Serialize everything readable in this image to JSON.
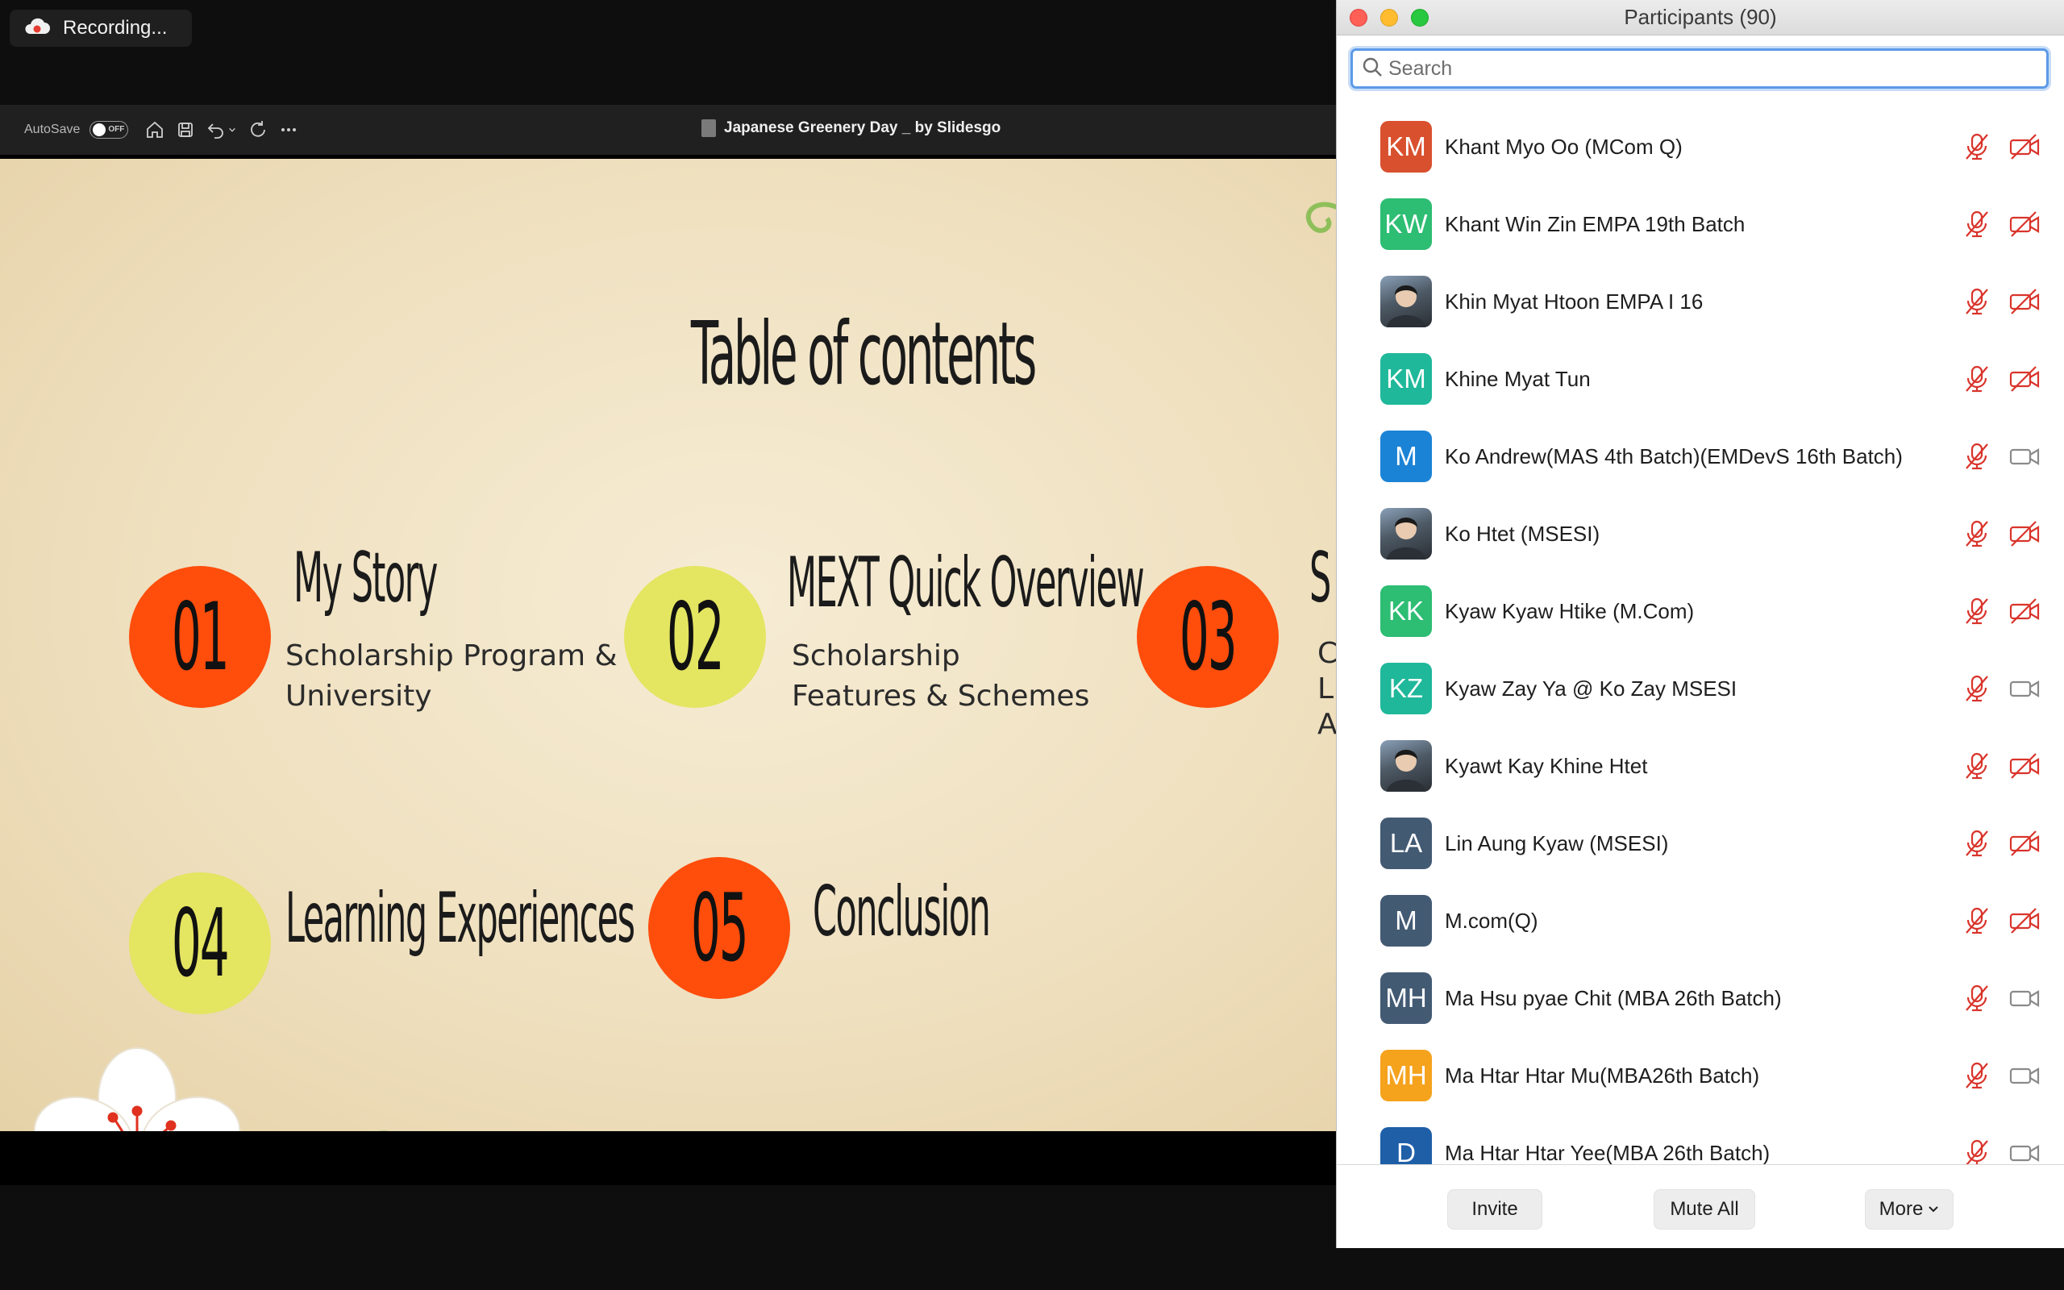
{
  "recording": {
    "label": "Recording..."
  },
  "ppt": {
    "autosave_label": "AutoSave",
    "autosave_state": "OFF",
    "document_title": "Japanese Greenery Day _ by Slidesgo"
  },
  "slide": {
    "title": "Table of contents",
    "sections": [
      {
        "number": "01",
        "title": "My Story",
        "subtitle_lines": [
          "Scholarship Program &",
          "University"
        ],
        "circle_color": "#ff4d0b"
      },
      {
        "number": "02",
        "title": "MEXT Quick Overview",
        "subtitle_lines": [
          "Scholarship",
          "Features & Schemes"
        ],
        "circle_color": "#e4e561"
      },
      {
        "number": "03",
        "title": "S",
        "subtitle_lines": [
          "C",
          "Li",
          "A"
        ],
        "circle_color": "#ff4d0b"
      },
      {
        "number": "04",
        "title": "Learning Experiences",
        "subtitle_lines": [],
        "circle_color": "#e4e561"
      },
      {
        "number": "05",
        "title": "Conclusion",
        "subtitle_lines": [],
        "circle_color": "#ff4d0b"
      }
    ]
  },
  "panel": {
    "title": "Participants (90)",
    "search_placeholder": "Search",
    "participants": [
      {
        "initials": "KM",
        "name": "Khant Myo Oo (MCom Q)",
        "avatar_color": "#d9502e",
        "photo": false,
        "mic": "muted",
        "video": "off"
      },
      {
        "initials": "KW",
        "name": "Khant Win Zin EMPA 19th Batch",
        "avatar_color": "#2dbd73",
        "photo": false,
        "mic": "muted",
        "video": "off"
      },
      {
        "initials": "",
        "name": "Khin Myat Htoon EMPA I 16",
        "avatar_color": "#55606b",
        "photo": true,
        "mic": "muted",
        "video": "off"
      },
      {
        "initials": "KM",
        "name": "Khine Myat Tun",
        "avatar_color": "#1fb89a",
        "photo": false,
        "mic": "muted",
        "video": "off"
      },
      {
        "initials": "M",
        "name": "Ko Andrew(MAS 4th Batch)(EMDevS 16th Batch)",
        "avatar_color": "#1b83d6",
        "photo": false,
        "mic": "muted",
        "video": "on"
      },
      {
        "initials": "",
        "name": "Ko Htet (MSESI)",
        "avatar_color": "#6e8aa6",
        "photo": true,
        "mic": "muted",
        "video": "off"
      },
      {
        "initials": "KK",
        "name": "Kyaw Kyaw Htike (M.Com)",
        "avatar_color": "#2dbd73",
        "photo": false,
        "mic": "muted",
        "video": "off"
      },
      {
        "initials": "KZ",
        "name": "Kyaw Zay Ya @ Ko Zay MSESI",
        "avatar_color": "#1fb89a",
        "photo": false,
        "mic": "muted",
        "video": "on"
      },
      {
        "initials": "",
        "name": "Kyawt Kay Khine Htet",
        "avatar_color": "#8a7a66",
        "photo": true,
        "mic": "muted",
        "video": "off"
      },
      {
        "initials": "LA",
        "name": "Lin Aung Kyaw (MSESI)",
        "avatar_color": "#435a73",
        "photo": false,
        "mic": "muted",
        "video": "off"
      },
      {
        "initials": "M",
        "name": "M.com(Q)",
        "avatar_color": "#435a73",
        "photo": false,
        "mic": "muted",
        "video": "off"
      },
      {
        "initials": "MH",
        "name": "Ma Hsu pyae Chit (MBA 26th Batch)",
        "avatar_color": "#435a73",
        "photo": false,
        "mic": "muted",
        "video": "on"
      },
      {
        "initials": "MH",
        "name": "Ma Htar Htar Mu(MBA26th Batch)",
        "avatar_color": "#f5a21d",
        "photo": false,
        "mic": "muted",
        "video": "on"
      },
      {
        "initials": "D",
        "name": "Ma Htar Htar Yee(MBA 26th Batch)",
        "avatar_color": "#1f5fa8",
        "photo": false,
        "mic": "muted",
        "video": "on"
      }
    ],
    "footer": {
      "invite": "Invite",
      "mute_all": "Mute All",
      "more": "More"
    }
  },
  "colors": {
    "muted_red": "#d9342b",
    "video_grey": "#8a8a8a",
    "search_focus": "#5c9ae8"
  }
}
